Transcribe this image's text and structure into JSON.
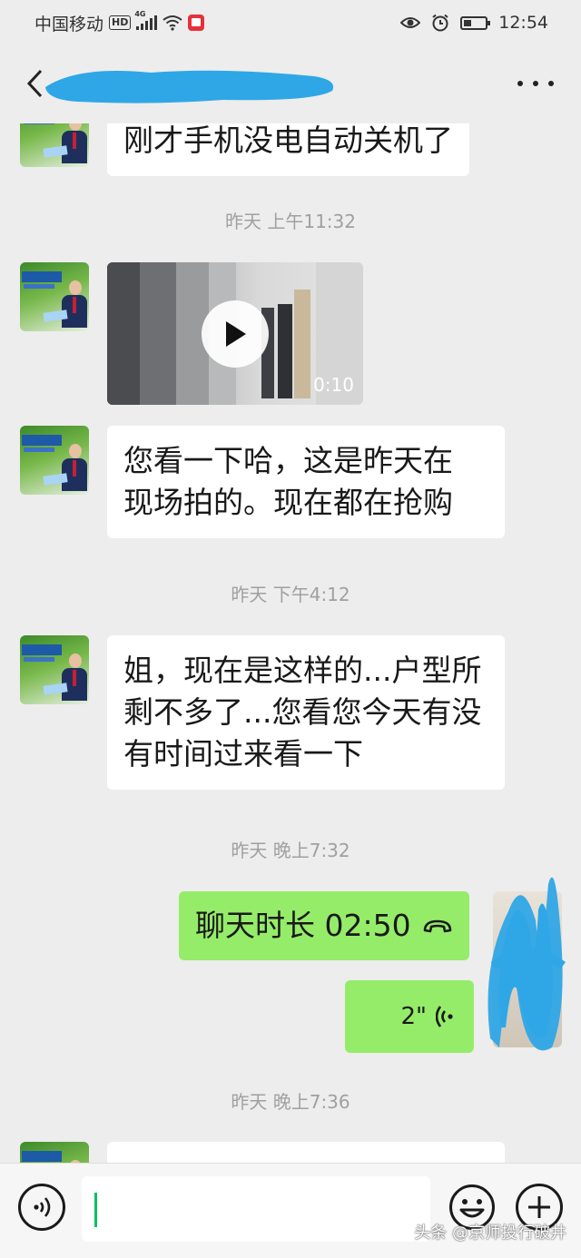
{
  "status_bar": {
    "carrier": "中国移动",
    "hd": "HD",
    "network": "4G",
    "time": "12:54",
    "icons": [
      "signal-icon",
      "wifi-icon",
      "red-app-icon",
      "eye-comfort-icon",
      "alarm-icon",
      "battery-icon"
    ]
  },
  "nav": {
    "back_icon": "chevron-left-icon",
    "more_icon": "more-dots-icon"
  },
  "messages": [
    {
      "type": "text",
      "side": "received",
      "lines": [
        "刚才手机没电自动关机了"
      ]
    },
    {
      "type": "time",
      "text": "昨天 上午11:32"
    },
    {
      "type": "video",
      "side": "received",
      "duration": "0:10"
    },
    {
      "type": "text",
      "side": "received",
      "lines": [
        "您看一下哈，这是昨天在",
        "现场拍的。现在都在抢购"
      ]
    },
    {
      "type": "time",
      "text": "昨天 下午4:12"
    },
    {
      "type": "text",
      "side": "received",
      "lines": [
        "姐，现在是这样的...户型所",
        "剩不多了...您看您今天有没",
        "有时间过来看一下"
      ]
    },
    {
      "type": "time",
      "text": "昨天 晚上7:32"
    },
    {
      "type": "call",
      "side": "sent",
      "text": "聊天时长 02:50"
    },
    {
      "type": "voice",
      "side": "sent",
      "duration": "2\""
    },
    {
      "type": "time",
      "text": "昨天 晚上7:36"
    }
  ],
  "input_bar": {
    "voice_icon": "voice-input-icon",
    "emoji_icon": "emoji-icon",
    "plus_icon": "plus-icon",
    "value": ""
  },
  "watermark": "头条 @京师投行破井",
  "colors": {
    "background": "#ededed",
    "sent_bubble": "#95ec69",
    "received_bubble": "#ffffff",
    "redaction": "#2fa7e6",
    "caret": "#07c160"
  }
}
